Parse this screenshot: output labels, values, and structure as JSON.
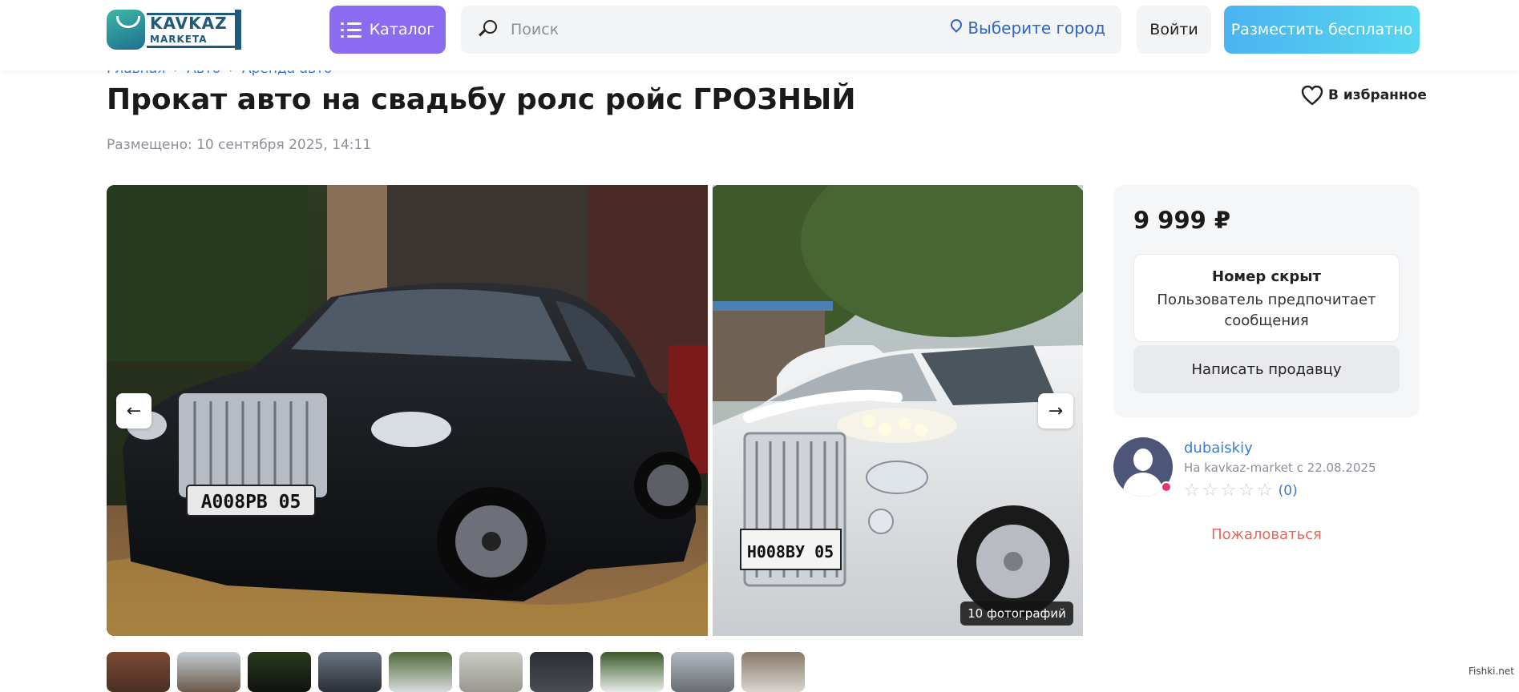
{
  "header": {
    "logo_line1": "KAVKAZ",
    "logo_line2": "MARKETA",
    "catalog_label": "Каталог",
    "search_placeholder": "Поиск",
    "city_label": "Выберите город",
    "login_label": "Войти",
    "post_label": "Разместить бесплатно"
  },
  "breadcrumbs": [
    "Главная",
    "Авто",
    "Аренда авто"
  ],
  "listing": {
    "title": "Прокат авто на свадьбу ролс ройс ГРОЗНЫЙ",
    "favorite_label": "В избранное",
    "posted": "Размещено: 10 сентября 2025, 14:11",
    "photo_count": "10 фотографий",
    "plate_1": "А008РВ 05",
    "plate_2": "Н008ВУ 05"
  },
  "price_card": {
    "price": "9 999 ₽",
    "hidden_title": "Номер скрыт",
    "hidden_text": "Пользователь предпочитает сообщения",
    "write_label": "Написать продавцу"
  },
  "seller": {
    "name": "dubaiskiy",
    "since": "На kavkaz-market с 22.08.2025",
    "rating_count": "(0)",
    "stars_filled": 0,
    "stars_total": 5
  },
  "report_label": "Пожаловаться",
  "watermark": "Fishki.net",
  "colors": {
    "catalog_bg": "#8b6cf0",
    "link_blue": "#3a7bd5",
    "report_red": "#e26a5a",
    "online_dot": "#e8336c"
  }
}
